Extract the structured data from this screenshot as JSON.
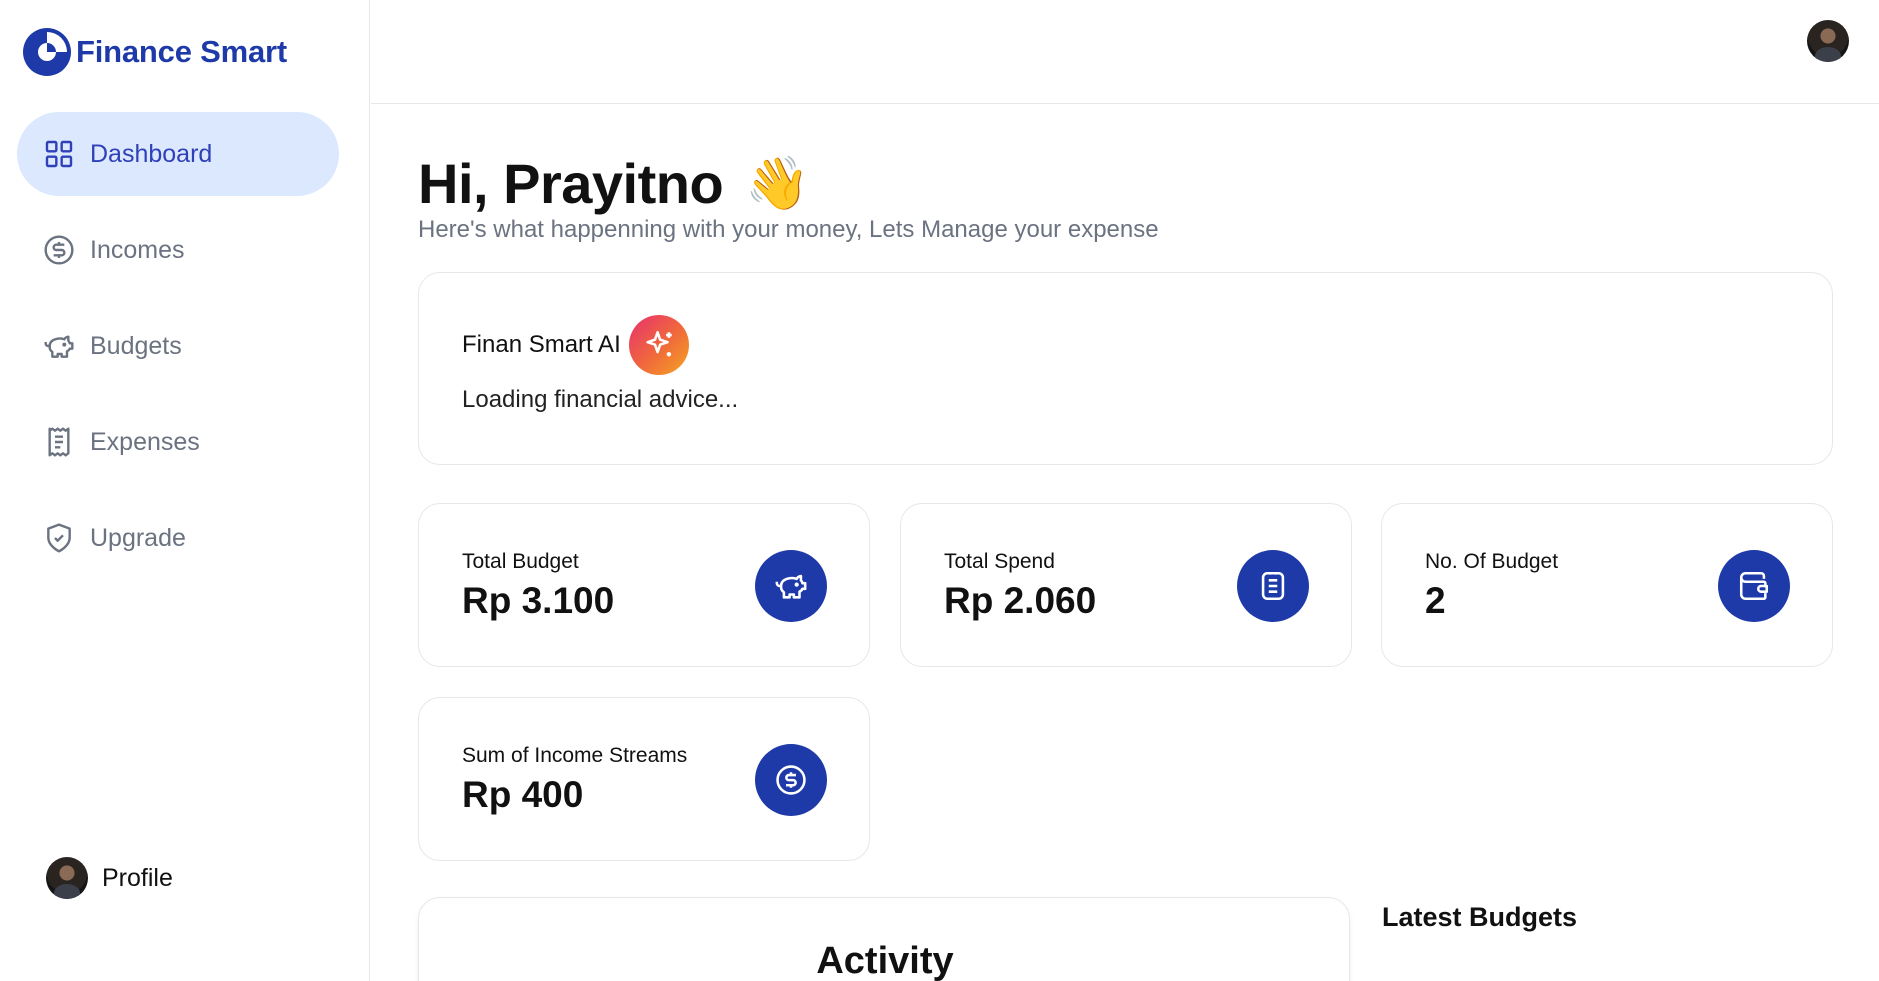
{
  "app": {
    "name": "Finance Smart",
    "brand_color": "#1e3aa8"
  },
  "sidebar": {
    "items": [
      {
        "label": "Dashboard",
        "icon": "layout-grid-icon",
        "active": true
      },
      {
        "label": "Incomes",
        "icon": "circle-dollar-icon",
        "active": false
      },
      {
        "label": "Budgets",
        "icon": "piggy-bank-icon",
        "active": false
      },
      {
        "label": "Expenses",
        "icon": "receipt-icon",
        "active": false
      },
      {
        "label": "Upgrade",
        "icon": "shield-check-icon",
        "active": false
      }
    ],
    "profile_label": "Profile"
  },
  "greeting": {
    "title": "Hi, Prayitno",
    "emoji": "👋",
    "subtitle": "Here's what happenning with your money, Lets Manage your expense"
  },
  "ai_card": {
    "title": "Finan Smart AI",
    "icon": "sparkles-icon",
    "text": "Loading financial advice..."
  },
  "stats": [
    {
      "label": "Total Budget",
      "value": "Rp 3.100",
      "icon": "piggy-bank-icon"
    },
    {
      "label": "Total Spend",
      "value": "Rp 2.060",
      "icon": "receipt-text-icon"
    },
    {
      "label": "No. Of Budget",
      "value": "2",
      "icon": "wallet-icon"
    },
    {
      "label": "Sum of Income Streams",
      "value": "Rp 400",
      "icon": "circle-dollar-icon"
    }
  ],
  "activity": {
    "title": "Activity"
  },
  "latest_budgets": {
    "title": "Latest Budgets"
  }
}
